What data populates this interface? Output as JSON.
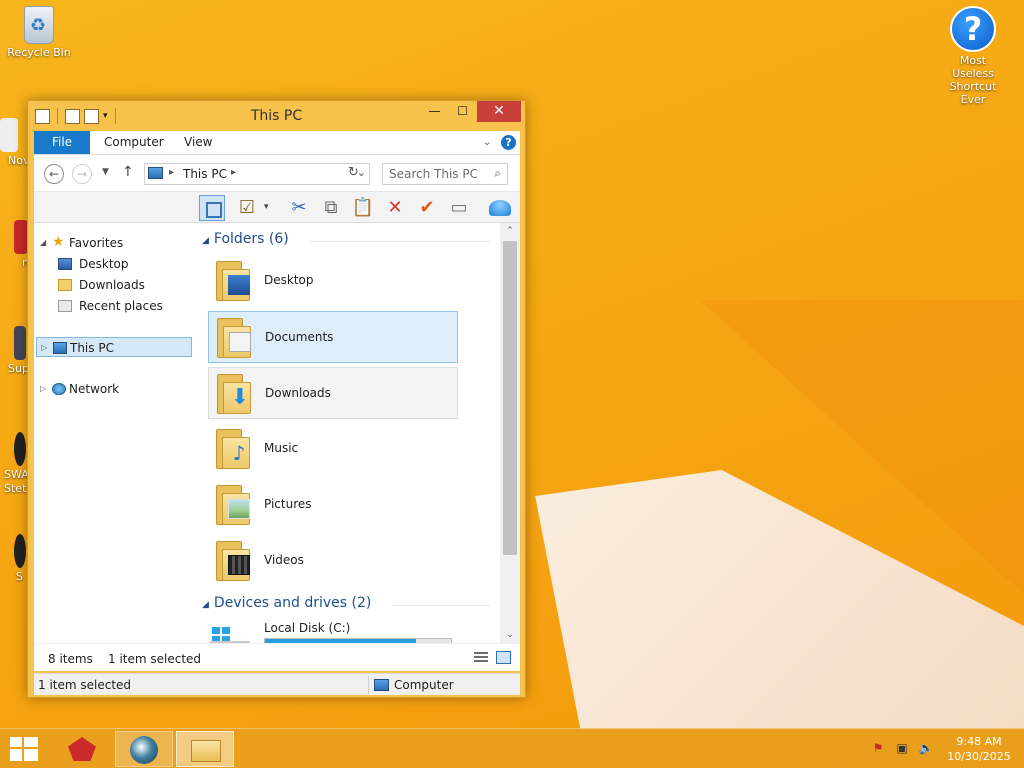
{
  "desktop": {
    "icons": [
      {
        "label": "Recycle Bin"
      },
      {
        "label": "Most Useless Shortcut Ever"
      }
    ],
    "partial_icons": [
      "Nov",
      "n",
      "Sup",
      "SWA\nStet",
      "S"
    ]
  },
  "window": {
    "title": "This PC",
    "controls": {
      "minimize": "—",
      "maximize": "☐",
      "close": "✕"
    },
    "ribbon": {
      "tabs": [
        {
          "label": "File",
          "active": true
        },
        {
          "label": "Computer"
        },
        {
          "label": "View"
        }
      ],
      "help": "?"
    },
    "address": {
      "crumbs": [
        "This PC"
      ],
      "search_placeholder": "Search This PC"
    },
    "navigation_pane": {
      "favorites": {
        "label": "Favorites",
        "items": [
          "Desktop",
          "Downloads",
          "Recent places"
        ]
      },
      "this_pc": {
        "label": "This PC",
        "selected": true
      },
      "network": {
        "label": "Network"
      }
    },
    "content": {
      "folders_header": "Folders (6)",
      "folders": [
        {
          "name": "Desktop",
          "icon": "folder-desktop-icon"
        },
        {
          "name": "Documents",
          "icon": "folder-documents-icon",
          "state": "selected"
        },
        {
          "name": "Downloads",
          "icon": "folder-downloads-icon",
          "state": "hover"
        },
        {
          "name": "Music",
          "icon": "folder-music-icon"
        },
        {
          "name": "Pictures",
          "icon": "folder-pictures-icon"
        },
        {
          "name": "Videos",
          "icon": "folder-videos-icon"
        }
      ],
      "devices_header": "Devices and drives (2)",
      "drives": [
        {
          "name": "Local Disk (C:)",
          "usage_fraction": 0.81
        }
      ]
    },
    "status": {
      "count": "8 items",
      "selection": "1 item selected"
    },
    "outer_status": {
      "selection": "1 item selected",
      "zone": "Computer"
    }
  },
  "taskbar": {
    "clock_time": "9:48 AM",
    "clock_date": "10/30/2025"
  },
  "colors": {
    "desktop_bg": "#f6a713",
    "accent": "#1979ca",
    "close": "#c7413a",
    "drive_bar": "#26a0da"
  }
}
